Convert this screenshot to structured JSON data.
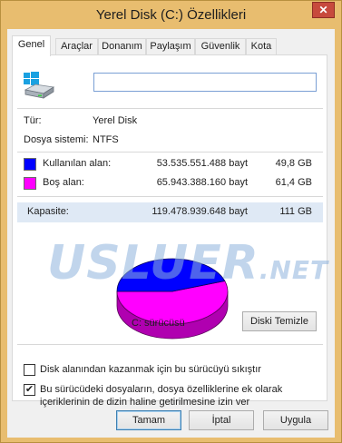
{
  "window": {
    "title": "Yerel Disk (C:) Özellikleri",
    "close_glyph": "✕"
  },
  "tabs": [
    {
      "label": "Genel",
      "active": true
    },
    {
      "label": "Araçlar"
    },
    {
      "label": "Donanım"
    },
    {
      "label": "Paylaşım"
    },
    {
      "label": "Güvenlik"
    },
    {
      "label": "Kota"
    }
  ],
  "general": {
    "drive_name_value": "",
    "type_label": "Tür:",
    "type_value": "Yerel Disk",
    "fs_label": "Dosya sistemi:",
    "fs_value": "NTFS",
    "used": {
      "label": "Kullanılan alan:",
      "bytes": "53.535.551.488 bayt",
      "size": "49,8 GB",
      "color": "#0000ff"
    },
    "free": {
      "label": "Boş alan:",
      "bytes": "65.943.388.160 bayt",
      "size": "61,4 GB",
      "color": "#ff00ff"
    },
    "capacity": {
      "label": "Kapasite:",
      "bytes": "119.478.939.648 bayt",
      "size": "111 GB"
    },
    "drive_label": "C: sürücüsü",
    "cleanup_button": "Diski Temizle",
    "watermark": "USLUER",
    "watermark_suffix": ".NET",
    "compress_label": "Disk alanından kazanmak için bu sürücüyü sıkıştır",
    "compress_checked": false,
    "index_label_line1": "Bu sürücüdeki dosyaların, dosya özelliklerine ek olarak",
    "index_label_line2": "içeriklerinin de dizin haline getirilmesine izin ver",
    "index_checked": true,
    "check_glyph": "✔"
  },
  "buttons": {
    "ok": "Tamam",
    "cancel": "İptal",
    "apply": "Uygula"
  },
  "pie_data": {
    "used_fraction": 0.448
  },
  "icons": {
    "drive": "hard-drive-icon",
    "windows": "windows-logo-icon"
  }
}
